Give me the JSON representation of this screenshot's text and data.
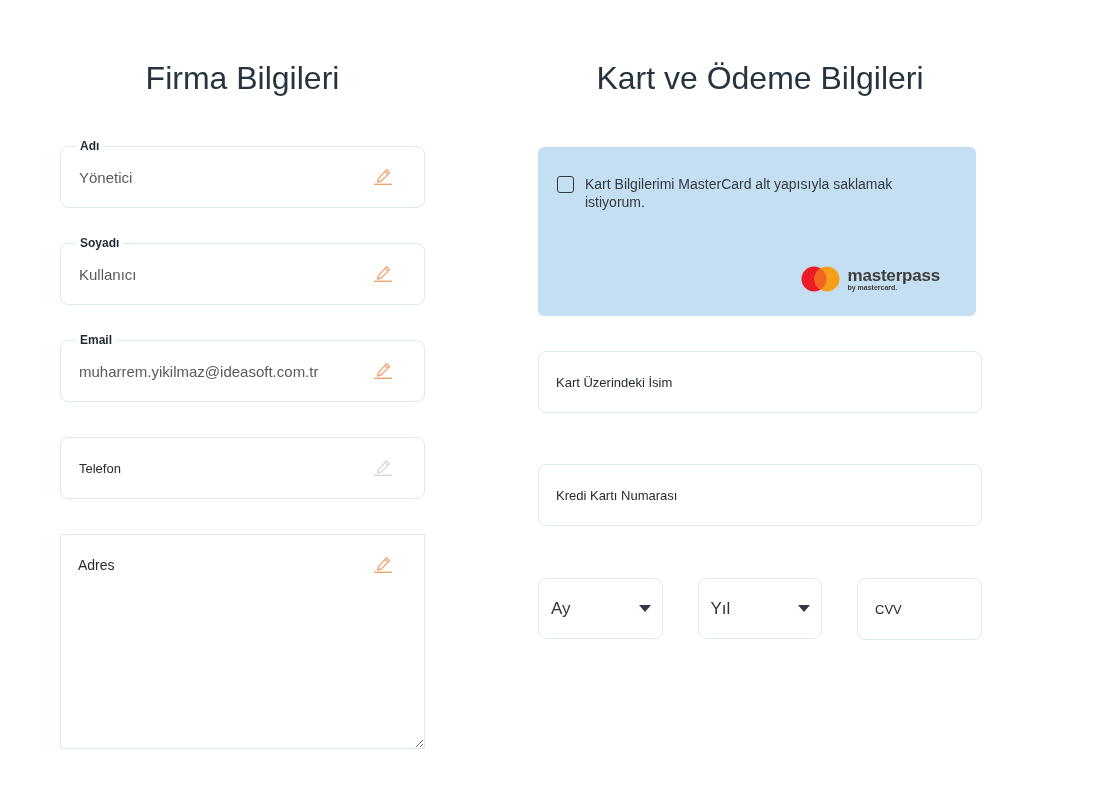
{
  "company_info": {
    "title": "Firma Bilgileri",
    "fields": [
      {
        "kind": "input",
        "label": "Adı",
        "value": "Yönetici",
        "edit_disabled": false
      },
      {
        "kind": "input",
        "label": "Soyadı",
        "value": "Kullanıcı",
        "edit_disabled": false
      },
      {
        "kind": "input",
        "label": "Email",
        "value": "muharrem.yikilmaz@ideasoft.com.tr",
        "edit_disabled": false
      },
      {
        "kind": "input",
        "placeholder": "Telefon",
        "edit_disabled": true
      },
      {
        "kind": "textarea",
        "placeholder": "Adres",
        "edit_disabled": false
      }
    ]
  },
  "payment_info": {
    "title": "Kart ve Ödeme Bilgileri",
    "save_card": {
      "checked": false,
      "label": "Kart Bilgilerimi MasterCard alt yapısıyla saklamak istiyorum."
    },
    "logo": {
      "wordmark": "masterpass",
      "tagline": "by mastercard."
    },
    "fields": [
      {
        "kind": "input",
        "placeholder": "Kart Üzerindeki İsim"
      },
      {
        "kind": "input",
        "placeholder": "Kredi Kartı Numarası"
      }
    ],
    "expiry_row": [
      {
        "kind": "select",
        "value": "Ay"
      },
      {
        "kind": "select",
        "value": "Yıl"
      },
      {
        "kind": "input",
        "placeholder": "CVV"
      }
    ]
  }
}
